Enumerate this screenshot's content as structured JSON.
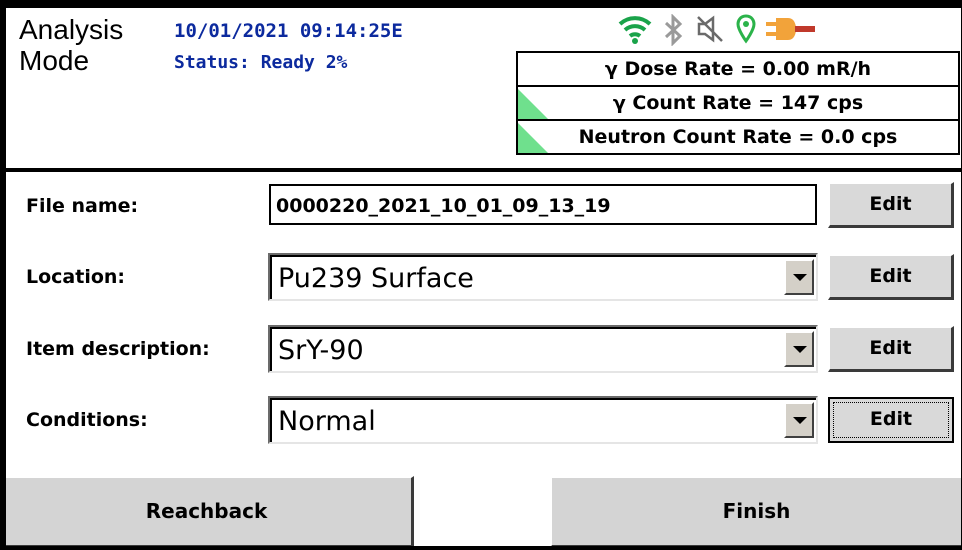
{
  "header": {
    "mode_line1": "Analysis",
    "mode_line2": "Mode",
    "timestamp": "10/01/2021 09:14:25E",
    "status": "Status: Ready 2%",
    "icons": [
      "wifi-icon",
      "bluetooth-icon",
      "speaker-muted-icon",
      "location-pin-icon",
      "power-plug-icon"
    ],
    "colors": {
      "header_text": "#0c2a9e",
      "indicator": "#6fe08d",
      "wifi": "#1aa34a",
      "location": "#2bb34a",
      "plug": "#f2a33a"
    }
  },
  "rates": {
    "dose": "γ Dose Rate = 0.00 mR/h",
    "gamma_count": "γ Count Rate = 147 cps",
    "neutron_count": "Neutron Count Rate = 0.0 cps"
  },
  "form": {
    "file_name_label": "File name:",
    "file_name_value": "0000220_2021_10_01_09_13_19",
    "location_label": "Location:",
    "location_value": "Pu239 Surface",
    "item_label": "Item description:",
    "item_value": "SrY-90",
    "conditions_label": "Conditions:",
    "conditions_value": "Normal",
    "edit_label": "Edit"
  },
  "buttons": {
    "reachback": "Reachback",
    "finish": "Finish"
  }
}
